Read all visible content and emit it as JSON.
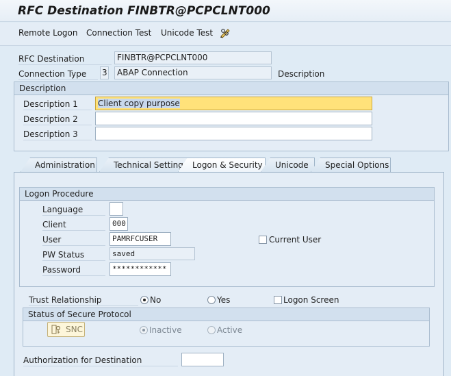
{
  "window": {
    "title": "RFC Destination FINBTR@PCPCLNT000"
  },
  "toolbar": {
    "remote_logon": "Remote Logon",
    "connection_test": "Connection Test",
    "unicode_test": "Unicode Test",
    "icon": "pencil-glasses-icon"
  },
  "header": {
    "rfc_destination_label": "RFC Destination",
    "rfc_destination_value": "FINBTR@PCPCLNT000",
    "connection_type_label": "Connection Type",
    "connection_type_code": "3",
    "connection_type_value": "ABAP Connection",
    "description_label": "Description"
  },
  "description_group": {
    "title": "Description",
    "desc1_label": "Description 1",
    "desc1_value": "Client copy purpose",
    "desc2_label": "Description 2",
    "desc2_value": "",
    "desc3_label": "Description 3",
    "desc3_value": ""
  },
  "tabs": [
    {
      "label": "Administration"
    },
    {
      "label": "Technical Settings"
    },
    {
      "label": "Logon & Security",
      "active": true
    },
    {
      "label": "Unicode"
    },
    {
      "label": "Special Options"
    }
  ],
  "logon": {
    "title": "Logon Procedure",
    "language_label": "Language",
    "language_value": "",
    "client_label": "Client",
    "client_value": "000",
    "user_label": "User",
    "user_value": "PAMRFCUSER",
    "current_user_label": "Current User",
    "current_user_checked": false,
    "pw_status_label": "PW Status",
    "pw_status_value": "saved",
    "password_label": "Password",
    "password_value": "************"
  },
  "trust": {
    "label": "Trust Relationship",
    "no_label": "No",
    "yes_label": "Yes",
    "selected": "No",
    "logon_screen_label": "Logon Screen",
    "logon_screen_checked": false
  },
  "secure_protocol": {
    "title": "Status of Secure Protocol",
    "snc_button": "SNC",
    "snc_icon": "key-lock-icon",
    "inactive_label": "Inactive",
    "active_label": "Active",
    "selected": "Inactive"
  },
  "authorization": {
    "label": "Authorization for Destination",
    "value": ""
  },
  "colors": {
    "background": "#dfebf5",
    "highlight": "#ffe27a",
    "group_header": "#d2e0ee"
  }
}
